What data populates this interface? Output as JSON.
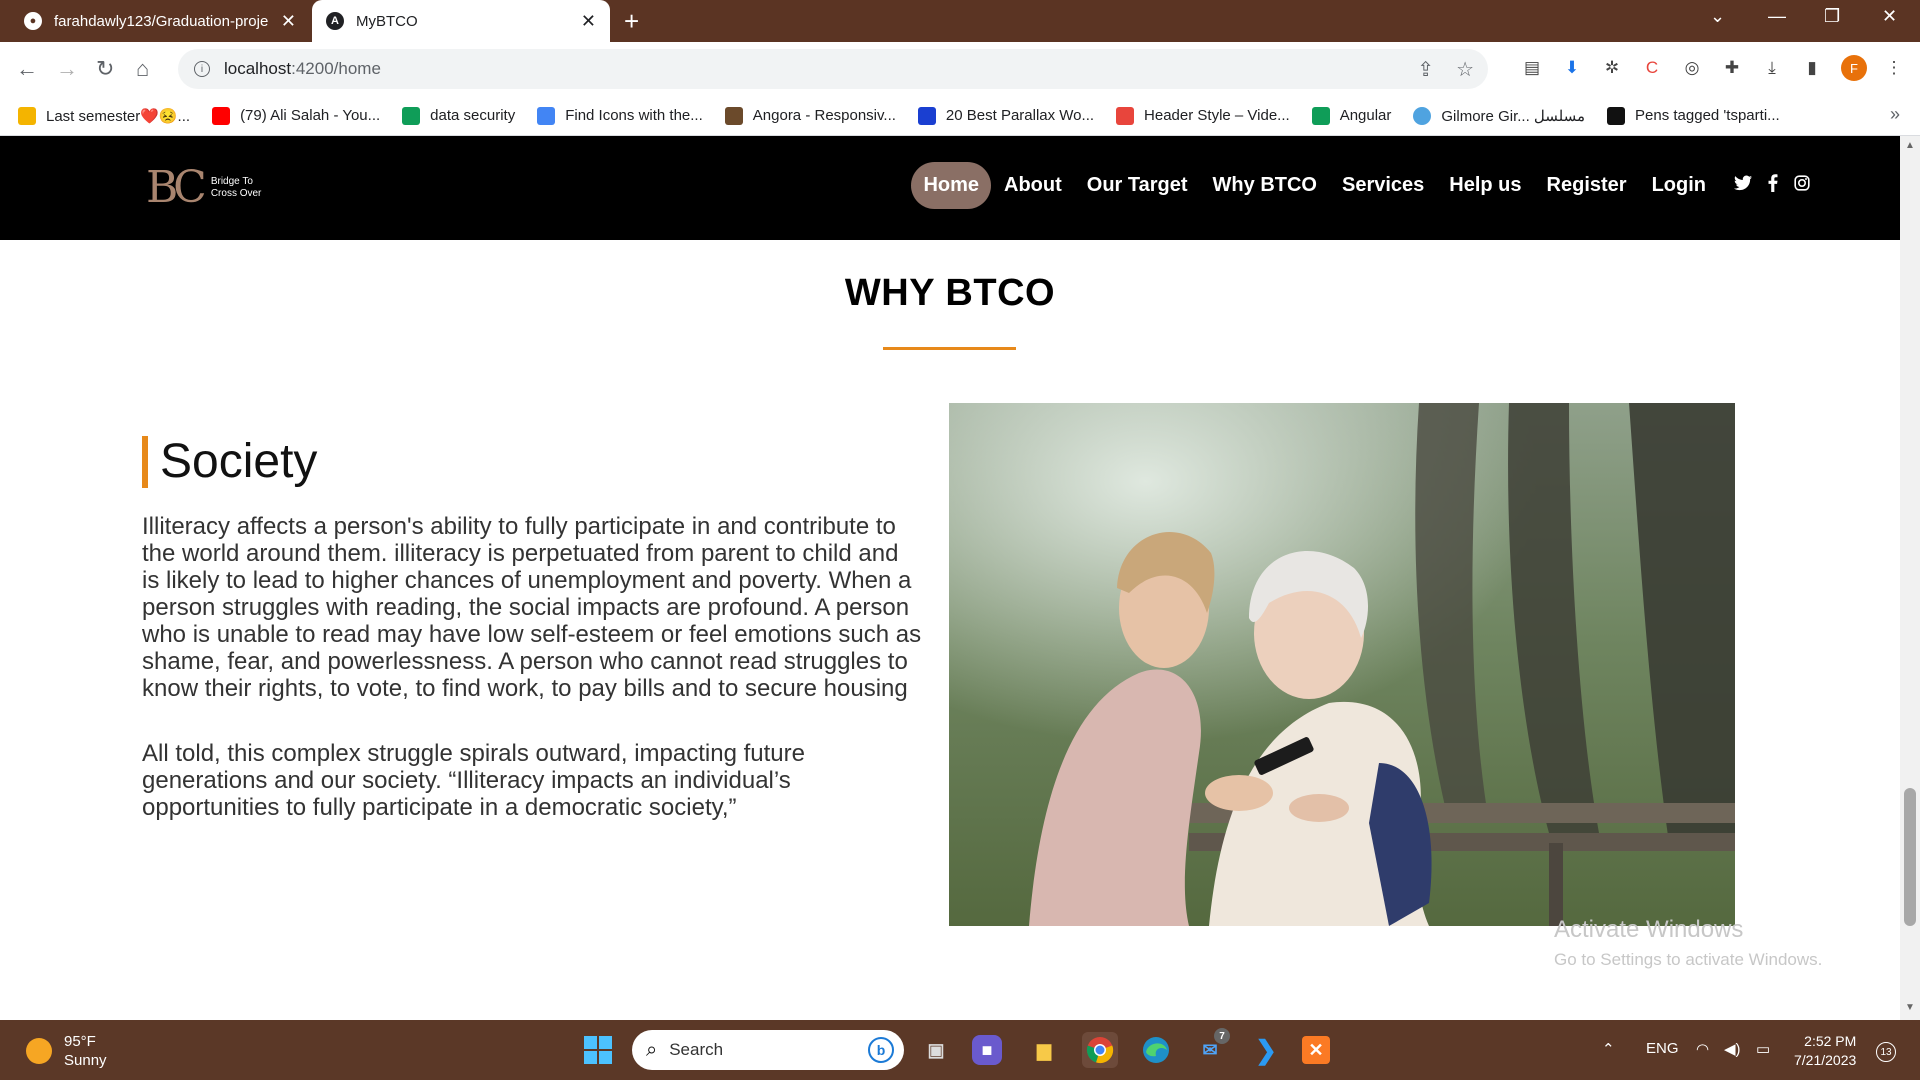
{
  "browser": {
    "tabs": [
      {
        "title": "farahdawly123/Graduation-proje",
        "icon": "github-icon"
      },
      {
        "title": "MyBTCO",
        "icon": "angular-icon"
      }
    ],
    "url_host": "localhost",
    "url_path": ":4200/home",
    "profile_initial": "F",
    "bookmarks": [
      {
        "label": "Last semester❤️😣...",
        "color": "#f4b400"
      },
      {
        "label": "(79) Ali Salah - You...",
        "color": "#ff0000"
      },
      {
        "label": "data security",
        "color": "#0f9d58"
      },
      {
        "label": "Find Icons with the...",
        "color": "#4285f4"
      },
      {
        "label": "Angora - Responsiv...",
        "color": "#6b4a2b"
      },
      {
        "label": "20 Best Parallax Wo...",
        "color": "#1a3fd1"
      },
      {
        "label": "Header Style – Vide...",
        "color": "#e8453c"
      },
      {
        "label": "Angular",
        "color": "#0f9d58"
      },
      {
        "label": "Gilmore Gir... مسلسل",
        "color": "#4fa3e0"
      },
      {
        "label": "Pens tagged 'tsparti...",
        "color": "#111111"
      }
    ]
  },
  "site": {
    "logo_mark": "BC",
    "logo_line1": "Bridge To",
    "logo_line2": "Cross Over",
    "menu": [
      "Home",
      "About",
      "Our Target",
      "Why BTCO",
      "Services",
      "Help us",
      "Register",
      "Login"
    ],
    "social": [
      "twitter-icon",
      "facebook-icon",
      "instagram-icon"
    ],
    "section_title": "WHY BTCO",
    "card_title": "Society",
    "paragraph1": "Illiteracy affects a person's ability to fully participate in and contribute to the world around them. illiteracy is perpetuated from parent to child and is likely to lead to higher chances of unemployment and poverty. When a person struggles with reading, the social impacts are profound. A person who is unable to read may have low self-esteem or feel emotions such as shame, fear, and powerlessness. A person who cannot read struggles to know their rights, to vote, to find work, to pay bills and to secure housing",
    "paragraph2": "All told, this complex struggle spirals outward, impacting future generations and our society. “Illiteracy impacts an individual’s opportunities to fully participate in a democratic society,”",
    "accent_color": "#e7891a"
  },
  "watermark": {
    "line1": "Activate Windows",
    "line2": "Go to Settings to activate Windows."
  },
  "taskbar": {
    "temperature": "95°F",
    "condition": "Sunny",
    "search_placeholder": "Search",
    "language": "ENG",
    "time": "2:52 PM",
    "date": "7/21/2023",
    "mail_badge": "7",
    "notifications": "13"
  }
}
